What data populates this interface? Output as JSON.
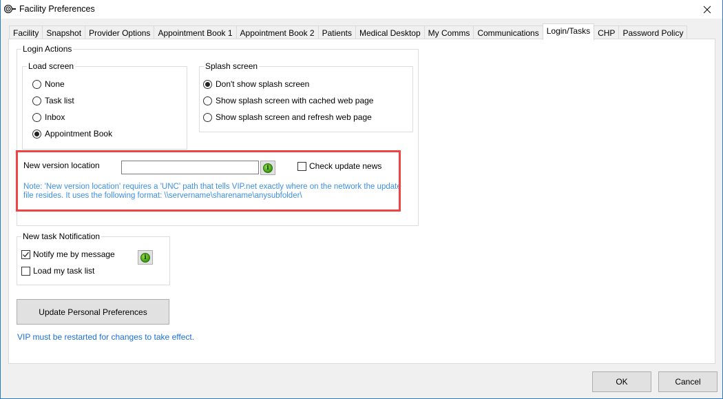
{
  "window": {
    "title": "Facility Preferences",
    "app_icon": "preferences-icon",
    "close_icon": "close-icon"
  },
  "tabs": [
    {
      "label": "Facility",
      "active": false
    },
    {
      "label": "Snapshot",
      "active": false
    },
    {
      "label": "Provider Options",
      "active": false
    },
    {
      "label": "Appointment Book 1",
      "active": false
    },
    {
      "label": "Appointment Book 2",
      "active": false
    },
    {
      "label": "Patients",
      "active": false
    },
    {
      "label": "Medical Desktop",
      "active": false
    },
    {
      "label": "My Comms",
      "active": false
    },
    {
      "label": "Communications",
      "active": false
    },
    {
      "label": "Login/Tasks",
      "active": true
    },
    {
      "label": "CHP",
      "active": false
    },
    {
      "label": "Password Policy",
      "active": false
    }
  ],
  "login_actions": {
    "legend": "Login Actions",
    "load_screen": {
      "legend": "Load screen",
      "options": [
        {
          "label": "None",
          "selected": false
        },
        {
          "label": "Task list",
          "selected": false
        },
        {
          "label": "Inbox",
          "selected": false
        },
        {
          "label": "Appointment Book",
          "selected": true
        }
      ]
    },
    "splash_screen": {
      "legend": "Splash screen",
      "options": [
        {
          "label": "Don't show splash screen",
          "selected": true
        },
        {
          "label": "Show splash screen with cached web page",
          "selected": false
        },
        {
          "label": "Show splash screen and refresh web page",
          "selected": false
        }
      ]
    },
    "new_version": {
      "label": "New version location",
      "value": "",
      "info_icon": "info-icon",
      "check_update_news": {
        "label": "Check update news",
        "checked": false
      },
      "note_line1": "Note: 'New version location' requires a 'UNC' path that tells VIP.net exactly where on the network the update",
      "note_line2": "file resides. It uses the following format:  \\\\servername\\sharename\\anysubfolder\\"
    }
  },
  "new_task_notification": {
    "legend": "New task Notification",
    "notify_by_message": {
      "label": "Notify me by message",
      "checked": true
    },
    "load_task_list": {
      "label": "Load my task list",
      "checked": false
    },
    "info_icon": "info-icon"
  },
  "update_button": "Update Personal Preferences",
  "restart_note": "VIP must be restarted for changes to take effect.",
  "footer": {
    "ok": "OK",
    "cancel": "Cancel"
  },
  "colors": {
    "highlight_border": "#ee4444",
    "note_text": "#3d8fe0",
    "restart_text": "#1a6fd0",
    "window_border": "#2b7bc6"
  }
}
